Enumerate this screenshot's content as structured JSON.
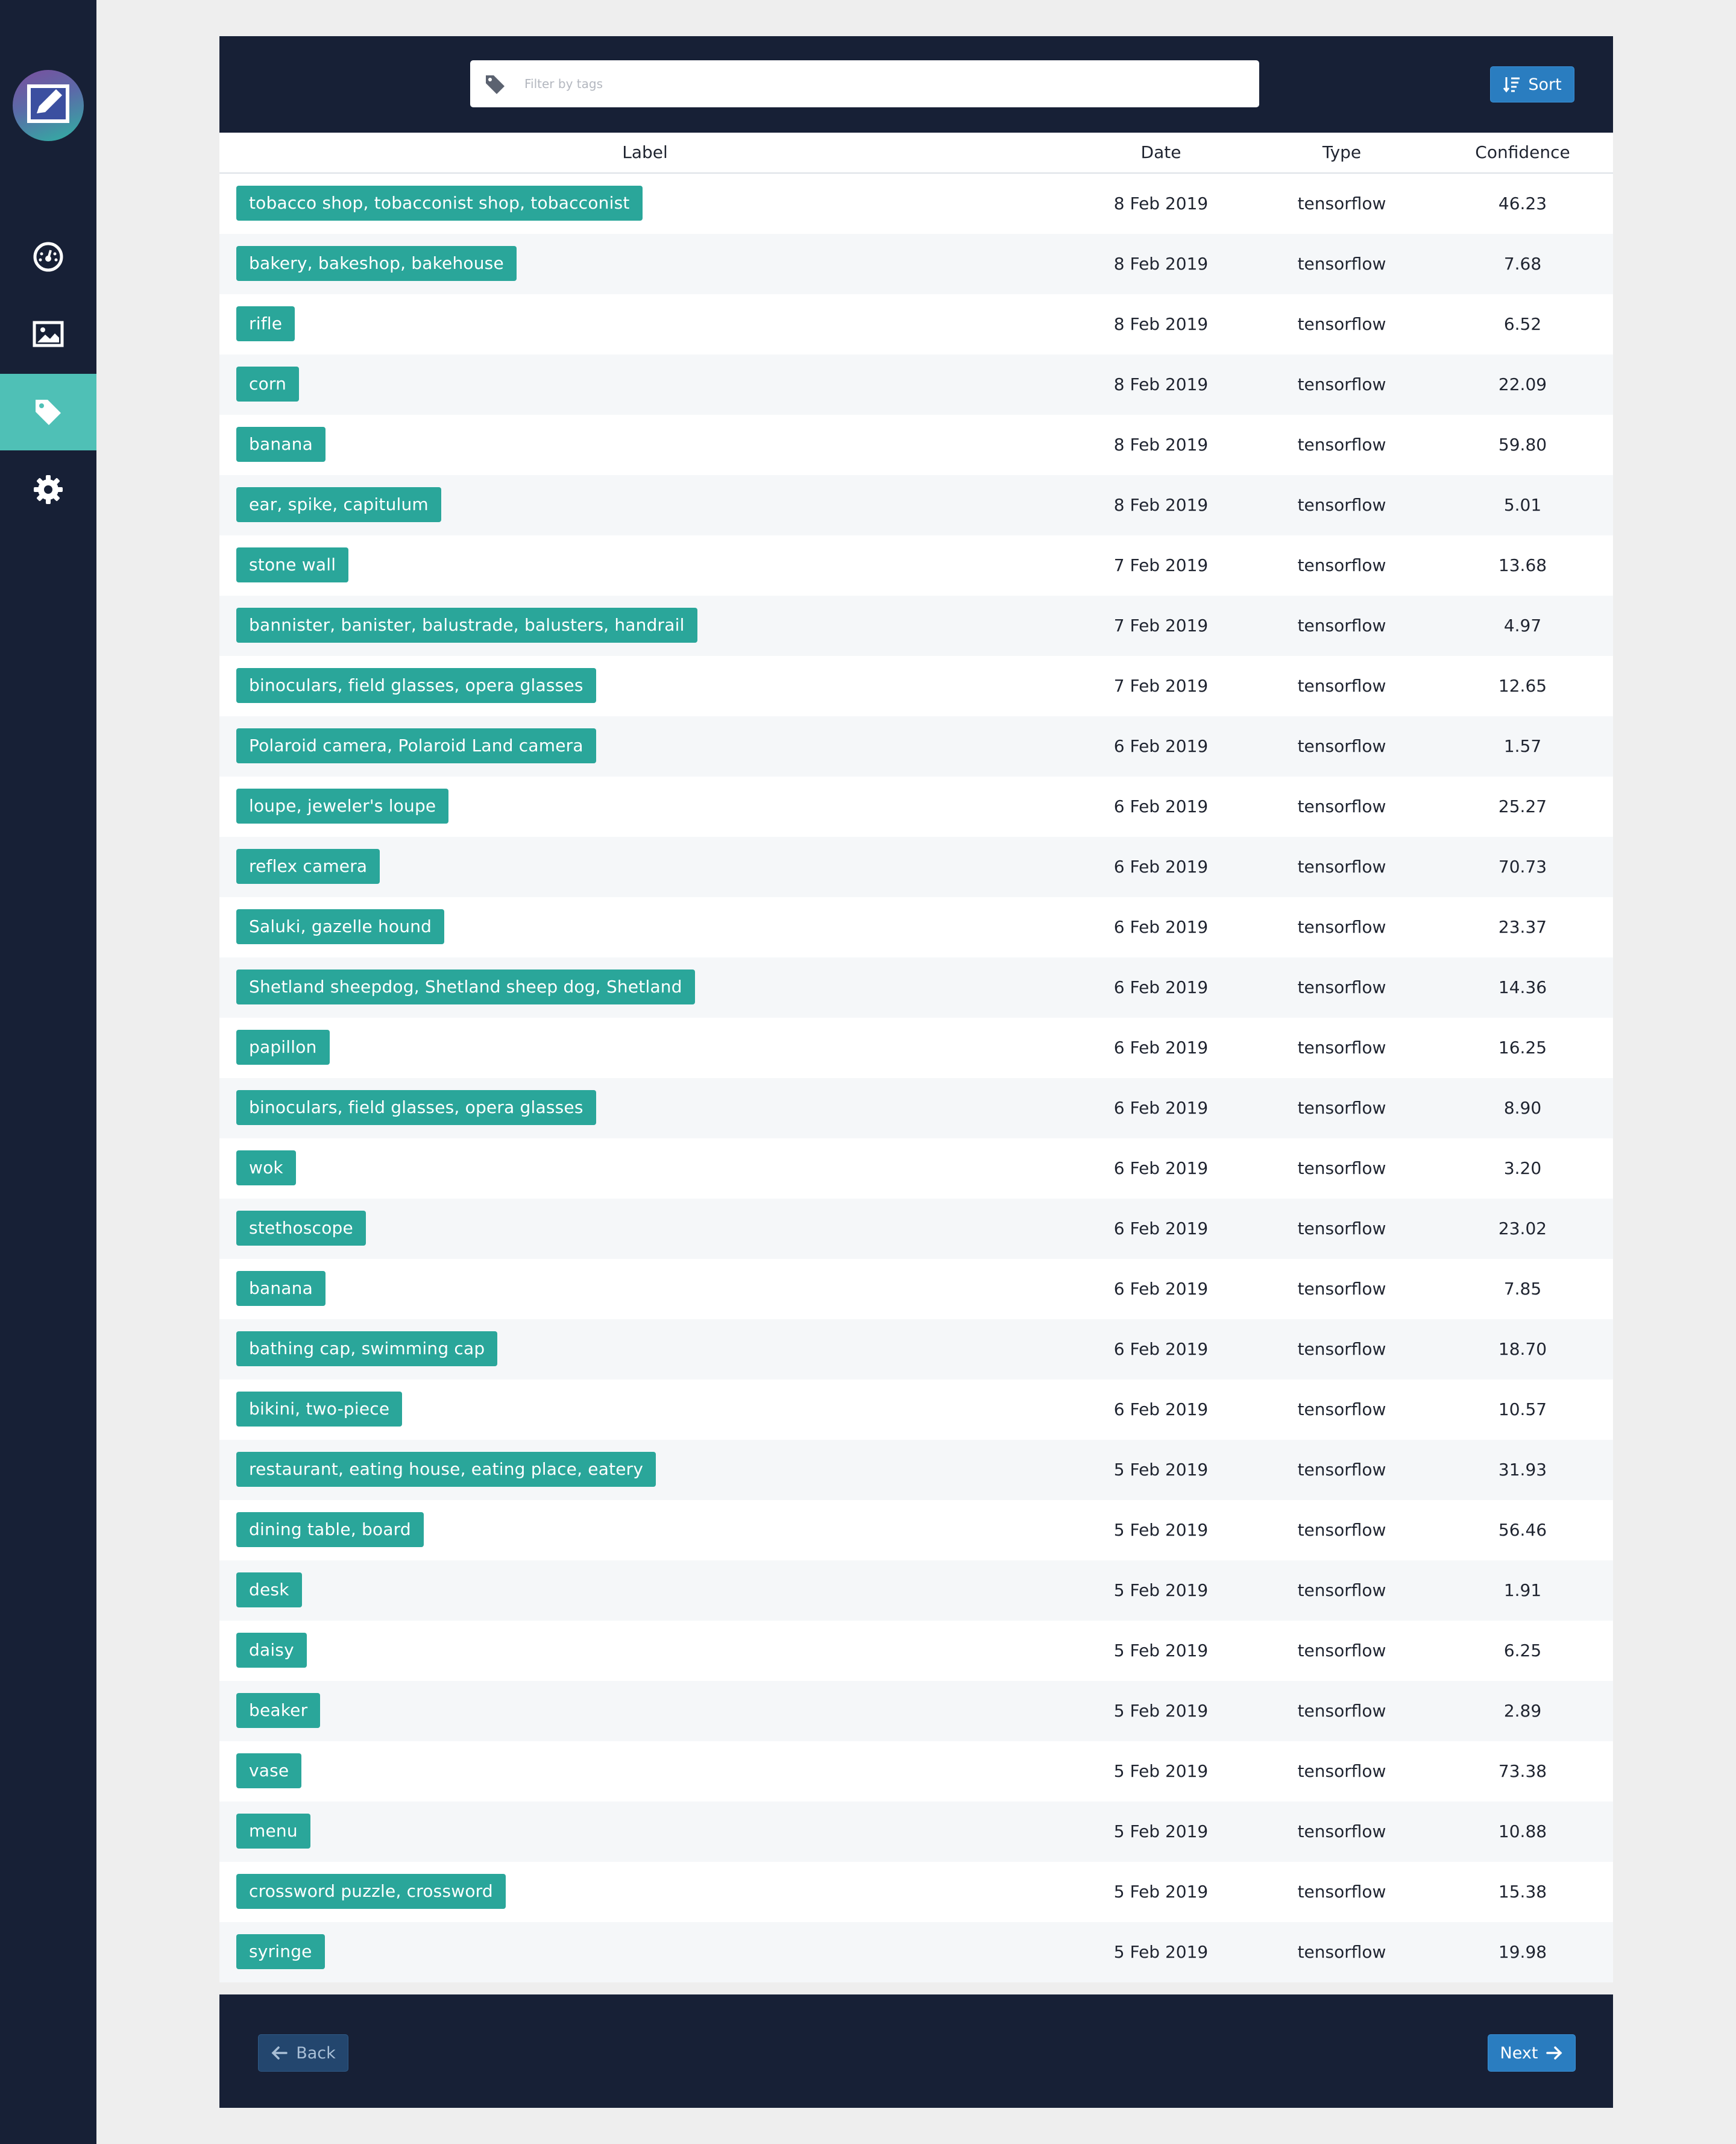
{
  "sidebar": {
    "items": [
      {
        "name": "dashboard-icon",
        "active": false
      },
      {
        "name": "image-icon",
        "active": false
      },
      {
        "name": "tag-icon",
        "active": true
      },
      {
        "name": "gear-icon",
        "active": false
      }
    ]
  },
  "header": {
    "filter_placeholder": "Filter by tags",
    "sort_label": "Sort"
  },
  "table": {
    "columns": {
      "label": "Label",
      "date": "Date",
      "type": "Type",
      "confidence": "Confidence"
    },
    "rows": [
      {
        "label": "tobacco shop, tobacconist shop, tobacconist",
        "date": "8 Feb 2019",
        "type": "tensorflow",
        "confidence": "46.23"
      },
      {
        "label": "bakery, bakeshop, bakehouse",
        "date": "8 Feb 2019",
        "type": "tensorflow",
        "confidence": "7.68"
      },
      {
        "label": "rifle",
        "date": "8 Feb 2019",
        "type": "tensorflow",
        "confidence": "6.52"
      },
      {
        "label": "corn",
        "date": "8 Feb 2019",
        "type": "tensorflow",
        "confidence": "22.09"
      },
      {
        "label": "banana",
        "date": "8 Feb 2019",
        "type": "tensorflow",
        "confidence": "59.80"
      },
      {
        "label": "ear, spike, capitulum",
        "date": "8 Feb 2019",
        "type": "tensorflow",
        "confidence": "5.01"
      },
      {
        "label": "stone wall",
        "date": "7 Feb 2019",
        "type": "tensorflow",
        "confidence": "13.68"
      },
      {
        "label": "bannister, banister, balustrade, balusters, handrail",
        "date": "7 Feb 2019",
        "type": "tensorflow",
        "confidence": "4.97"
      },
      {
        "label": "binoculars, field glasses, opera glasses",
        "date": "7 Feb 2019",
        "type": "tensorflow",
        "confidence": "12.65"
      },
      {
        "label": "Polaroid camera, Polaroid Land camera",
        "date": "6 Feb 2019",
        "type": "tensorflow",
        "confidence": "1.57"
      },
      {
        "label": "loupe, jeweler's loupe",
        "date": "6 Feb 2019",
        "type": "tensorflow",
        "confidence": "25.27"
      },
      {
        "label": "reflex camera",
        "date": "6 Feb 2019",
        "type": "tensorflow",
        "confidence": "70.73"
      },
      {
        "label": "Saluki, gazelle hound",
        "date": "6 Feb 2019",
        "type": "tensorflow",
        "confidence": "23.37"
      },
      {
        "label": "Shetland sheepdog, Shetland sheep dog, Shetland",
        "date": "6 Feb 2019",
        "type": "tensorflow",
        "confidence": "14.36"
      },
      {
        "label": "papillon",
        "date": "6 Feb 2019",
        "type": "tensorflow",
        "confidence": "16.25"
      },
      {
        "label": "binoculars, field glasses, opera glasses",
        "date": "6 Feb 2019",
        "type": "tensorflow",
        "confidence": "8.90"
      },
      {
        "label": "wok",
        "date": "6 Feb 2019",
        "type": "tensorflow",
        "confidence": "3.20"
      },
      {
        "label": "stethoscope",
        "date": "6 Feb 2019",
        "type": "tensorflow",
        "confidence": "23.02"
      },
      {
        "label": "banana",
        "date": "6 Feb 2019",
        "type": "tensorflow",
        "confidence": "7.85"
      },
      {
        "label": "bathing cap, swimming cap",
        "date": "6 Feb 2019",
        "type": "tensorflow",
        "confidence": "18.70"
      },
      {
        "label": "bikini, two-piece",
        "date": "6 Feb 2019",
        "type": "tensorflow",
        "confidence": "10.57"
      },
      {
        "label": "restaurant, eating house, eating place, eatery",
        "date": "5 Feb 2019",
        "type": "tensorflow",
        "confidence": "31.93"
      },
      {
        "label": "dining table, board",
        "date": "5 Feb 2019",
        "type": "tensorflow",
        "confidence": "56.46"
      },
      {
        "label": "desk",
        "date": "5 Feb 2019",
        "type": "tensorflow",
        "confidence": "1.91"
      },
      {
        "label": "daisy",
        "date": "5 Feb 2019",
        "type": "tensorflow",
        "confidence": "6.25"
      },
      {
        "label": "beaker",
        "date": "5 Feb 2019",
        "type": "tensorflow",
        "confidence": "2.89"
      },
      {
        "label": "vase",
        "date": "5 Feb 2019",
        "type": "tensorflow",
        "confidence": "73.38"
      },
      {
        "label": "menu",
        "date": "5 Feb 2019",
        "type": "tensorflow",
        "confidence": "10.88"
      },
      {
        "label": "crossword puzzle, crossword",
        "date": "5 Feb 2019",
        "type": "tensorflow",
        "confidence": "15.38"
      },
      {
        "label": "syringe",
        "date": "5 Feb 2019",
        "type": "tensorflow",
        "confidence": "19.98"
      }
    ]
  },
  "footer": {
    "back_label": "Back",
    "next_label": "Next"
  },
  "colors": {
    "navy": "#172036",
    "tag_teal": "#2aa69a",
    "active_nav": "#4fc0b6",
    "button_blue": "#2a7dc0"
  }
}
